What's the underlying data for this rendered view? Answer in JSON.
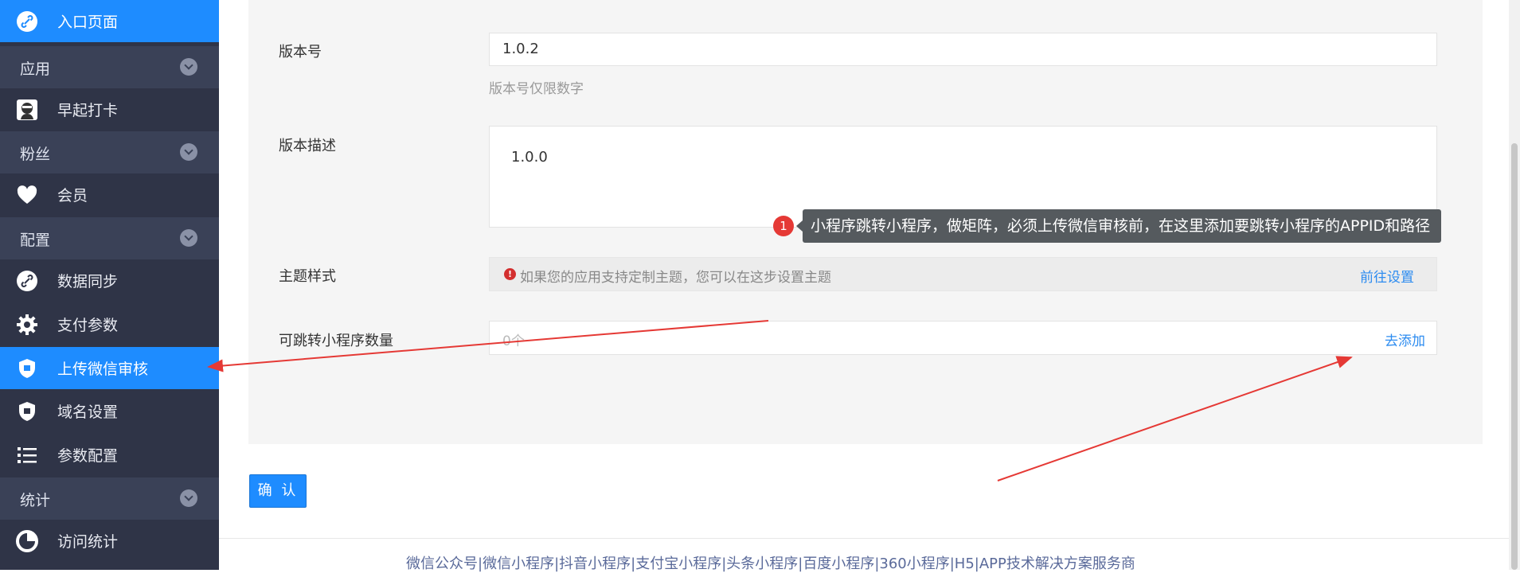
{
  "sidebar": {
    "entry": {
      "label": "入口页面",
      "icon": "link-icon"
    },
    "groups": [
      {
        "label": "应用",
        "items": [
          {
            "label": "早起打卡",
            "icon": "avatar-icon"
          }
        ]
      },
      {
        "label": "粉丝",
        "items": [
          {
            "label": "会员",
            "icon": "heart-icon"
          }
        ]
      },
      {
        "label": "配置",
        "items": [
          {
            "label": "数据同步",
            "icon": "link-icon"
          },
          {
            "label": "支付参数",
            "icon": "gear-icon"
          },
          {
            "label": "上传微信审核",
            "icon": "shield-icon",
            "active": true
          },
          {
            "label": "域名设置",
            "icon": "shield-icon"
          },
          {
            "label": "参数配置",
            "icon": "list-icon"
          }
        ]
      },
      {
        "label": "统计",
        "items": [
          {
            "label": "访问统计",
            "icon": "chart-icon"
          }
        ]
      }
    ]
  },
  "form": {
    "version": {
      "label": "版本号",
      "value": "1.0.2",
      "hint": "版本号仅限数字"
    },
    "description": {
      "label": "版本描述",
      "value": "1.0.0"
    },
    "theme": {
      "label": "主题样式",
      "notice": "如果您的应用支持定制主题，您可以在这步设置主题",
      "link": "前往设置"
    },
    "jump_count": {
      "label": "可跳转小程序数量",
      "placeholder": "0个",
      "link": "去添加"
    },
    "confirm_label": "确 认"
  },
  "annotation": {
    "badge": "1",
    "text": "小程序跳转小程序，做矩阵，必须上传微信审核前，在这里添加要跳转小程序的APPID和路径"
  },
  "footer": {
    "text": "微信公众号|微信小程序|抖音小程序|支付宝小程序|头条小程序|百度小程序|360小程序|H5|APP技术解决方案服务商"
  },
  "colors": {
    "sidebar": "#2f3447",
    "accent": "#1e8cff",
    "arrow": "#e53935"
  }
}
